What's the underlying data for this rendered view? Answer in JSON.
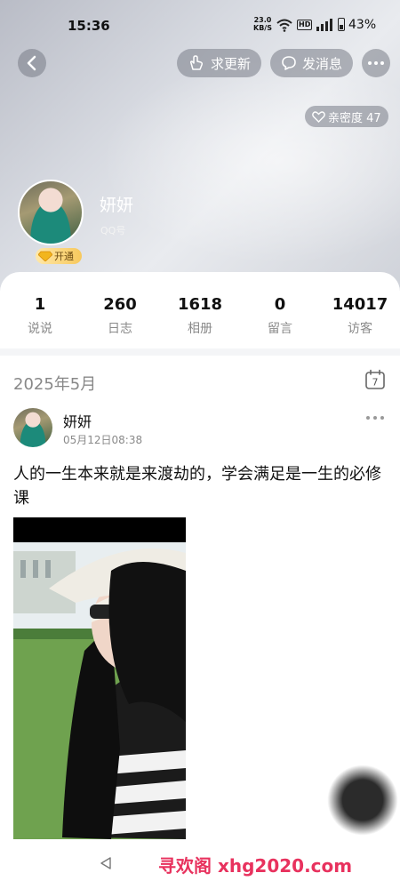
{
  "status_bar": {
    "time": "15:36",
    "net_speed_value": "23.0",
    "net_speed_unit": "KB/S",
    "hd_badge": "HD",
    "battery": "43%"
  },
  "header": {
    "request_update_label": "求更新",
    "send_message_label": "发消息",
    "intimacy_label": "亲密度 47"
  },
  "profile": {
    "nickname": "妍妍",
    "qq_label": "QQ号",
    "vip_label": "开通"
  },
  "stats": [
    {
      "value": "1",
      "label": "说说"
    },
    {
      "value": "260",
      "label": "日志"
    },
    {
      "value": "1618",
      "label": "相册"
    },
    {
      "value": "0",
      "label": "留言"
    },
    {
      "value": "14017",
      "label": "访客"
    }
  ],
  "timeline": {
    "month": "2025年5月",
    "calendar_day": "7"
  },
  "post": {
    "author": "妍妍",
    "time": "05月12日08:38",
    "text": "人的一生本来就是来渡劫的，学会满足是一生的必修课"
  },
  "watermark": "寻欢阁 xhg2020.com",
  "colors": {
    "watermark": "#e8325e",
    "vip_gold": "#f7c85c",
    "muted_text": "#8a8a8a"
  }
}
